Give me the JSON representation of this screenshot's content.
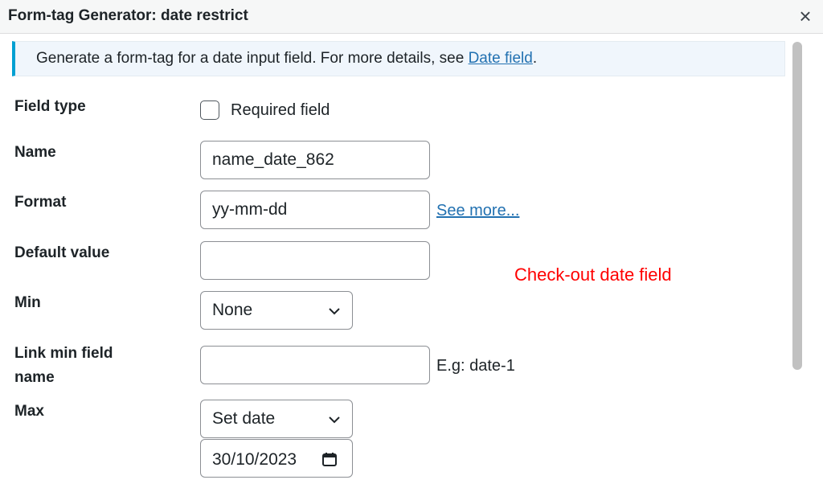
{
  "dialog": {
    "title": "Form-tag Generator: date restrict",
    "close_label": "×"
  },
  "notice": {
    "text": "Generate a form-tag for a date input field. For more details, see ",
    "link_text": "Date field",
    "suffix": "."
  },
  "fields": {
    "field_type": {
      "label": "Field type",
      "checkbox_label": "Required field",
      "checked": false
    },
    "name": {
      "label": "Name",
      "value": "name_date_862"
    },
    "format": {
      "label": "Format",
      "value": "yy-mm-dd",
      "link_text": "See more..."
    },
    "default_value": {
      "label": "Default value",
      "value": ""
    },
    "min": {
      "label": "Min",
      "selected": "None"
    },
    "link_min": {
      "label_line1": "Link min field",
      "label_line2": "name",
      "value": "",
      "hint": "E.g: date-1"
    },
    "max": {
      "label": "Max",
      "selected": "Set date",
      "date_value": "30/10/2023"
    }
  },
  "annotation": {
    "text": "Check-out date field",
    "color": "#ff0000"
  },
  "colors": {
    "accent": "#00a0d2",
    "link": "#2271b1"
  }
}
